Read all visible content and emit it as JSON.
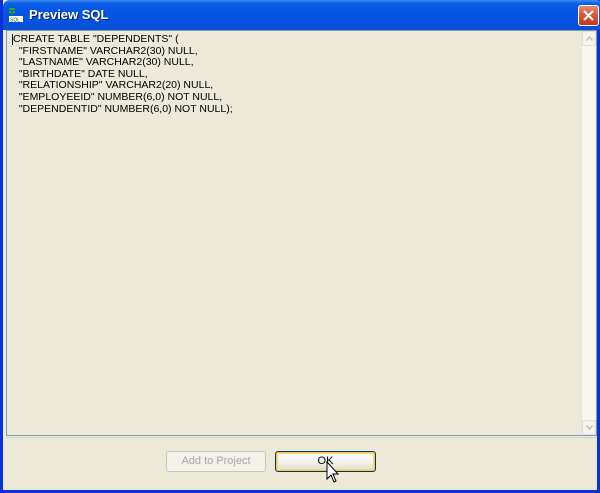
{
  "window": {
    "title": "Preview SQL",
    "title_bar_color": "#0453e2",
    "close_button_color": "#c1361c"
  },
  "icons": {
    "app": "db-schema-icon",
    "close": "close-icon",
    "scroll_up": "chevron-up-icon",
    "scroll_down": "chevron-down-icon",
    "cursor": "mouse-pointer-icon"
  },
  "sql": {
    "lines": [
      "CREATE TABLE \"DEPENDENTS\" (",
      "  \"FIRSTNAME\" VARCHAR2(30) NULL,",
      "  \"LASTNAME\" VARCHAR2(30) NULL,",
      "  \"BIRTHDATE\" DATE NULL,",
      "  \"RELATIONSHIP\" VARCHAR2(20) NULL,",
      "  \"EMPLOYEEID\" NUMBER(6,0) NOT NULL,",
      "  \"DEPENDENTID\" NUMBER(6,0) NOT NULL);"
    ]
  },
  "buttons": {
    "add_to_project": "Add to Project",
    "ok": "OK"
  }
}
